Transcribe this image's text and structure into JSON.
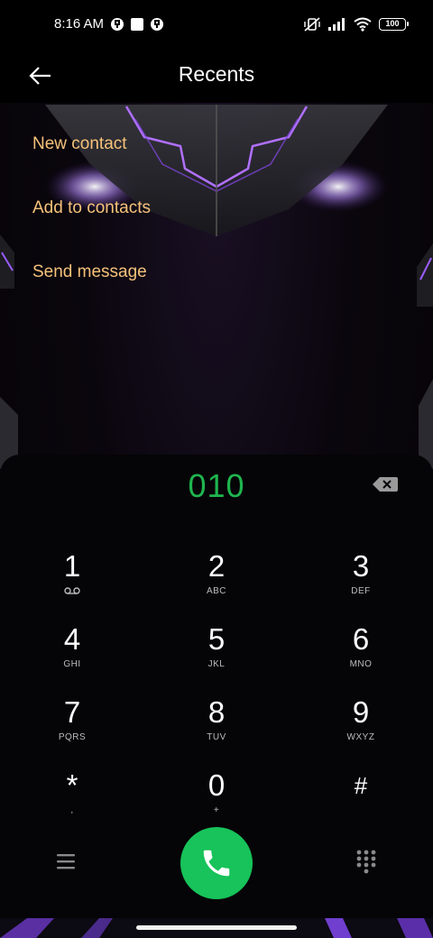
{
  "status_bar": {
    "time": "8:16 AM",
    "battery": "100",
    "icons": [
      "notification-icon",
      "square-icon",
      "notification-icon",
      "mute-vibrate-icon",
      "signal-icon",
      "wifi-icon",
      "battery-icon"
    ]
  },
  "header": {
    "title": "Recents",
    "back_icon": "back-arrow-icon"
  },
  "actions": [
    {
      "label": "New contact"
    },
    {
      "label": "Add to contacts"
    },
    {
      "label": "Send message"
    }
  ],
  "dialer": {
    "number": "010",
    "delete_icon": "backspace-icon",
    "number_color": "#1fb54e",
    "keys": [
      {
        "digit": "1",
        "letters": ""
      },
      {
        "digit": "2",
        "letters": "ABC"
      },
      {
        "digit": "3",
        "letters": "DEF"
      },
      {
        "digit": "4",
        "letters": "GHI"
      },
      {
        "digit": "5",
        "letters": "JKL"
      },
      {
        "digit": "6",
        "letters": "MNO"
      },
      {
        "digit": "7",
        "letters": "PQRS"
      },
      {
        "digit": "8",
        "letters": "TUV"
      },
      {
        "digit": "9",
        "letters": "WXYZ"
      },
      {
        "digit": "*",
        "letters": ","
      },
      {
        "digit": "0",
        "letters": "+"
      },
      {
        "digit": "#",
        "letters": ""
      }
    ]
  },
  "bottom_bar": {
    "menu_icon": "menu-icon",
    "call_icon": "phone-icon",
    "keypad_icon": "dialpad-icon",
    "call_color": "#17c35a"
  },
  "colors": {
    "accent_text": "#f6c27a",
    "background": "#050307"
  }
}
